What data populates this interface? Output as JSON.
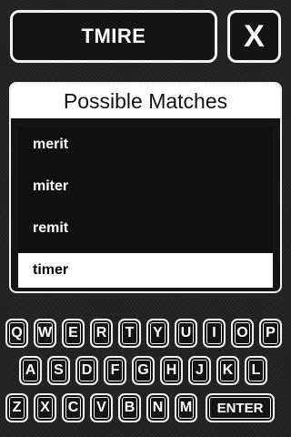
{
  "word": {
    "letters": "TMIRE"
  },
  "close": {
    "label": "X"
  },
  "matches": {
    "title": "Possible Matches",
    "items": [
      "merit",
      "miter",
      "remit",
      "timer"
    ],
    "selected_index": 3
  },
  "keyboard": {
    "rows": [
      [
        "Q",
        "W",
        "E",
        "R",
        "T",
        "Y",
        "U",
        "I",
        "O",
        "P"
      ],
      [
        "A",
        "S",
        "D",
        "F",
        "G",
        "H",
        "J",
        "K",
        "L"
      ],
      [
        "Z",
        "X",
        "C",
        "V",
        "B",
        "N",
        "M"
      ]
    ],
    "enter_label": "ENTER"
  },
  "colors": {
    "background": "#242424",
    "border": "#f2f2f2",
    "selected_row": "#ffffff"
  }
}
